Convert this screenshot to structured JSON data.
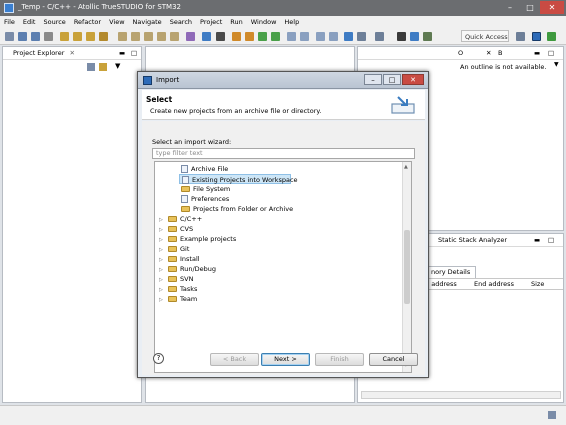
{
  "window": {
    "title": "_Temp - C/C++ - Atollic TrueSTUDIO for STM32"
  },
  "menu": {
    "items": [
      "File",
      "Edit",
      "Source",
      "Refactor",
      "View",
      "Navigate",
      "Search",
      "Project",
      "Run",
      "Window",
      "Help"
    ]
  },
  "toolbar": {
    "quick_access": "Quick Access"
  },
  "project_explorer": {
    "tab_label": "Project Explorer"
  },
  "outline": {
    "tab_label": "O",
    "tab2_label": "B",
    "message": "An outline is not available."
  },
  "stack_analyzer": {
    "tab_label": "Static Stack Analyzer",
    "subtab_label": "nory Details",
    "columns": [
      "rt address",
      "End address",
      "Size"
    ]
  },
  "dialog": {
    "title": "Import",
    "heading": "Select",
    "description": "Create new projects from an archive file or directory.",
    "wizard_label": "Select an import wizard:",
    "filter_placeholder": "type filter text",
    "general_items": [
      "Archive File",
      "Existing Projects into Workspace",
      "File System",
      "Preferences",
      "Projects from Folder or Archive"
    ],
    "categories": [
      "C/C++",
      "CVS",
      "Example projects",
      "Git",
      "Install",
      "Run/Debug",
      "SVN",
      "Tasks",
      "Team"
    ],
    "selected_item": "Existing Projects into Workspace",
    "buttons": {
      "back": "< Back",
      "next": "Next >",
      "finish": "Finish",
      "cancel": "Cancel"
    },
    "help_icon": "?"
  },
  "colors": {
    "titlebar": "#6b6d70",
    "dialog_bg": "#e9eef4",
    "selection": "#cde6f7"
  }
}
